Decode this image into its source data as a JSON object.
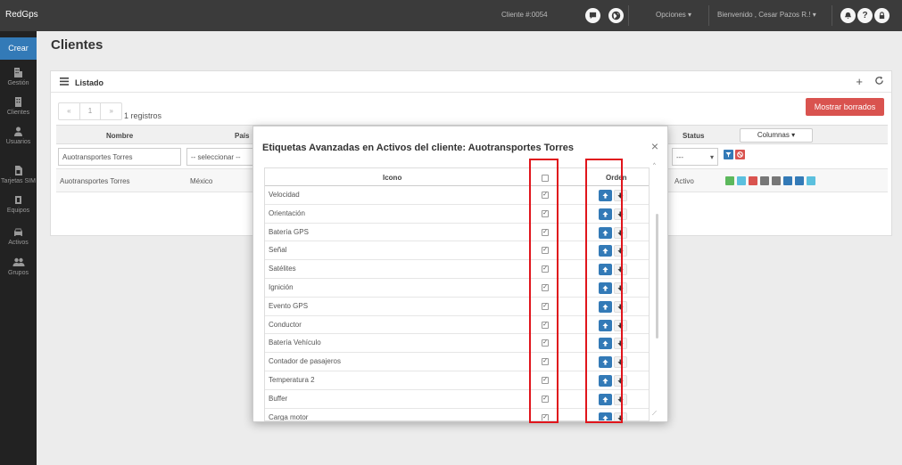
{
  "topbar": {
    "brand": "RedGps",
    "client_number": "Cliente #:0054",
    "opciones": "Opciones",
    "welcome": "Bienvenido , Cesar Pazos R.!"
  },
  "sidebar": {
    "create": "Crear",
    "items": [
      {
        "label": "Gestión",
        "icon": "building-icon"
      },
      {
        "label": "Clientes",
        "icon": "building-icon"
      },
      {
        "label": "Usuarios",
        "icon": "user-icon"
      },
      {
        "label": "Tarjetas SIM",
        "icon": "sim-icon"
      },
      {
        "label": "Equipos",
        "icon": "chip-icon"
      },
      {
        "label": "Activos",
        "icon": "car-icon"
      },
      {
        "label": "Grupos",
        "icon": "group-icon"
      }
    ]
  },
  "page": {
    "title": "Clientes",
    "panel_title": "Listado",
    "pager": {
      "prev": "«",
      "page": "1",
      "next": "»"
    },
    "records": "1 registros",
    "show_deleted": "Mostrar borrados",
    "columns_button": "Columnas",
    "headers": {
      "nombre": "Nombre",
      "pais": "País",
      "status": "Status"
    },
    "filters": {
      "nombre": "Auotransportes Torres",
      "pais": "-- seleccionar --",
      "status": "---"
    },
    "row": {
      "nombre": "Auotransportes Torres",
      "pais": "México",
      "status": "Activo"
    }
  },
  "modal": {
    "title": "Etiquetas Avanzadas en Activos del cliente: Auotransportes Torres",
    "close": "×",
    "col_icono": "Icono",
    "col_orden": "Orden",
    "rows": [
      {
        "label": "Velocidad",
        "checked": true
      },
      {
        "label": "Orientación",
        "checked": true
      },
      {
        "label": "Batería GPS",
        "checked": true
      },
      {
        "label": "Señal",
        "checked": true
      },
      {
        "label": "Satélites",
        "checked": true
      },
      {
        "label": "Ignición",
        "checked": true
      },
      {
        "label": "Evento GPS",
        "checked": true
      },
      {
        "label": "Conductor",
        "checked": true
      },
      {
        "label": "Batería Vehículo",
        "checked": true
      },
      {
        "label": "Contador de pasajeros",
        "checked": true
      },
      {
        "label": "Temperatura 2",
        "checked": true
      },
      {
        "label": "Buffer",
        "checked": true
      },
      {
        "label": "Carga motor",
        "checked": true
      }
    ]
  },
  "colors": {
    "primary": "#337ab7",
    "danger": "#d9534f",
    "success": "#5cb85c",
    "highlight": "#e0151c"
  }
}
